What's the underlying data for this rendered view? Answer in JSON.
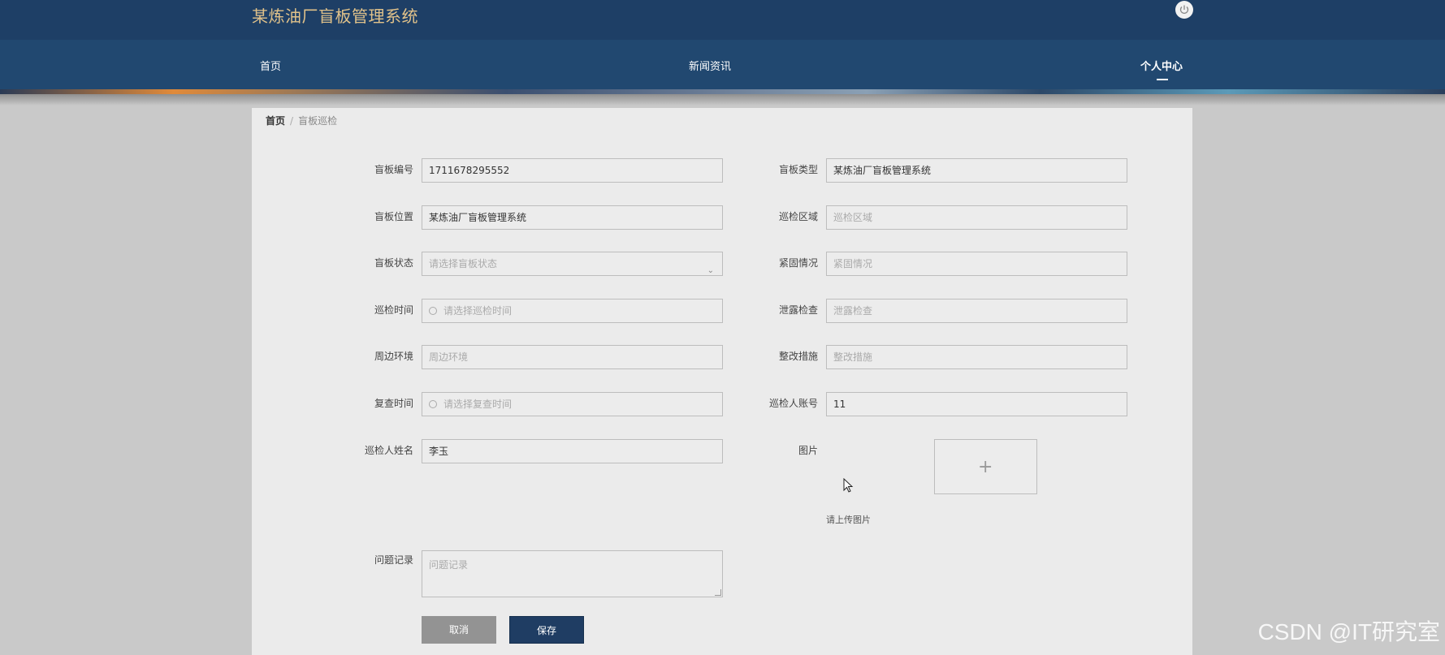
{
  "header": {
    "title": "某炼油厂盲板管理系统",
    "power_icon": "power-icon"
  },
  "nav": {
    "items": [
      "首页",
      "新闻资讯",
      "个人中心"
    ],
    "active": "个人中心"
  },
  "breadcrumb": {
    "home": "首页",
    "separator": "/",
    "current": "盲板巡检"
  },
  "form": {
    "blind_no": {
      "label": "盲板编号",
      "value": "1711678295552"
    },
    "blind_type": {
      "label": "盲板类型",
      "value": "某炼油厂盲板管理系统"
    },
    "blind_location": {
      "label": "盲板位置",
      "value": "某炼油厂盲板管理系统"
    },
    "inspection_area": {
      "label": "巡检区域",
      "placeholder": "巡检区域"
    },
    "blind_status": {
      "label": "盲板状态",
      "placeholder": "请选择盲板状态"
    },
    "fastening": {
      "label": "紧固情况",
      "placeholder": "紧固情况"
    },
    "inspection_time": {
      "label": "巡检时间",
      "placeholder": "请选择巡检时间"
    },
    "leak_check": {
      "label": "泄露检查",
      "placeholder": "泄露检查"
    },
    "surroundings": {
      "label": "周边环境",
      "placeholder": "周边环境"
    },
    "rectification": {
      "label": "整改措施",
      "placeholder": "整改措施"
    },
    "recheck_time": {
      "label": "复查时间",
      "placeholder": "请选择复查时间"
    },
    "inspector_account": {
      "label": "巡检人账号",
      "value": "11"
    },
    "inspector_name": {
      "label": "巡检人姓名",
      "value": "李玉"
    },
    "image": {
      "label": "图片",
      "hint": "请上传图片",
      "plus": "+"
    },
    "issue_record": {
      "label": "问题记录",
      "placeholder": "问题记录"
    }
  },
  "buttons": {
    "cancel": "取消",
    "save": "保存"
  },
  "watermark": "CSDN @IT研究室",
  "colors": {
    "header_bg": "#1e3f66",
    "nav_bg": "#214870",
    "title": "#e1c28a",
    "save_btn": "#1f3d63",
    "cancel_btn": "#939393"
  }
}
